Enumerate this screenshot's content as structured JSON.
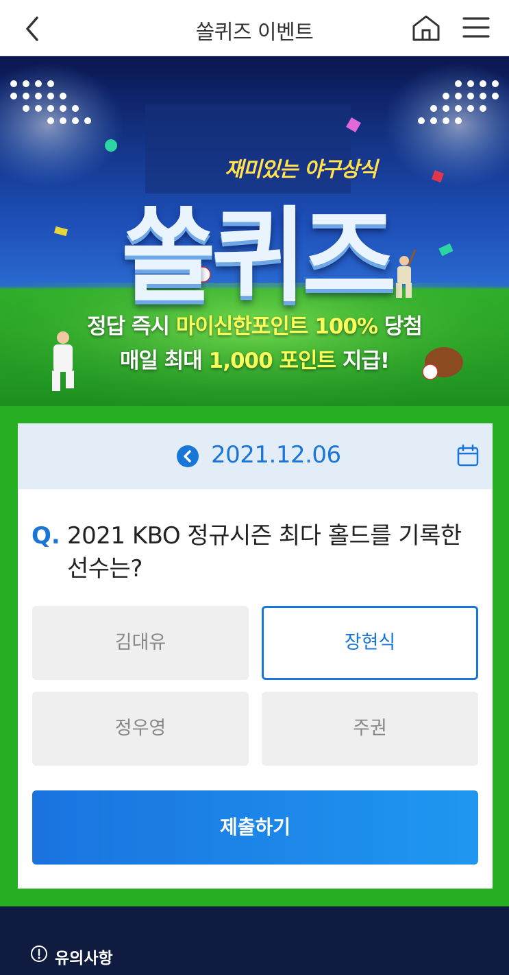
{
  "header": {
    "title": "쏠퀴즈 이벤트",
    "back_icon": "chevron-left-icon",
    "home_icon": "home-icon",
    "menu_icon": "hamburger-menu-icon"
  },
  "hero": {
    "tagline": "재미있는 야구상식",
    "big_title": "쏠퀴즈",
    "line1_a": "정답 즉시 ",
    "line1_hl": "마이신한포인트 100%",
    "line1_b": " 당첨",
    "line2_a": "매일 최대 ",
    "line2_hl": "1,000 포인트",
    "line2_b": " 지급!"
  },
  "quiz": {
    "date": "2021.12.06",
    "prev_icon": "chevron-left-circle-icon",
    "calendar_icon": "calendar-icon",
    "q_mark": "Q.",
    "question": "2021 KBO 정규시즌 최다 홀드를 기록한 선수는?",
    "options": [
      {
        "label": "김대유",
        "selected": false
      },
      {
        "label": "장현식",
        "selected": true
      },
      {
        "label": "정우영",
        "selected": false
      },
      {
        "label": "주권",
        "selected": false
      }
    ],
    "submit_label": "제출하기"
  },
  "footer": {
    "notice_label": "유의사항",
    "notice_icon": "info-circle-icon"
  },
  "colors": {
    "accent": "#1976d8",
    "field_green": "#27b024",
    "footer_navy": "#0f1c3f"
  }
}
